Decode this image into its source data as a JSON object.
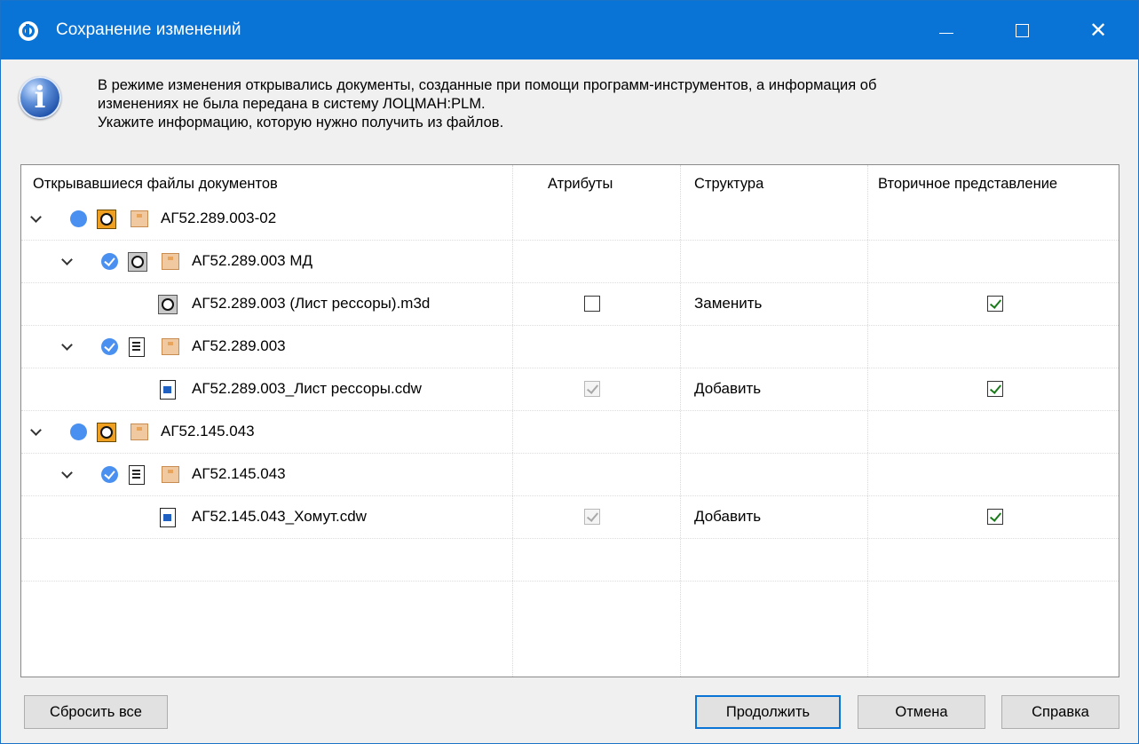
{
  "window": {
    "title": "Сохранение изменений"
  },
  "message": {
    "line1": "В режиме изменения открывались документы, созданные при помощи программ-инструментов, а информация об",
    "line2": "изменениях не была передана в систему ЛОЦМАН:PLM.",
    "line3": "Укажите информацию, которую нужно получить из файлов."
  },
  "table": {
    "headers": {
      "files": "Открывавшиеся файлы документов",
      "attributes": "Атрибуты",
      "structure": "Структура",
      "secondary": "Вторичное представление"
    },
    "rows": [
      {
        "label": "АГ52.289.003-02",
        "level": 0,
        "expanded": true,
        "status": "dot",
        "icon": "assembly-icon"
      },
      {
        "label": "АГ52.289.003 МД",
        "level": 1,
        "expanded": true,
        "status": "check",
        "icon": "part-icon"
      },
      {
        "label": "АГ52.289.003 (Лист рессоры).m3d",
        "level": 2,
        "icon": "part-file-icon",
        "attributes": "unchecked",
        "structure": "Заменить",
        "secondary": "checked"
      },
      {
        "label": "АГ52.289.003",
        "level": 1,
        "expanded": true,
        "status": "check",
        "icon": "document-icon"
      },
      {
        "label": "АГ52.289.003_Лист рессоры.cdw",
        "level": 2,
        "icon": "drawing-file-icon",
        "attributes": "disabled-checked",
        "structure": "Добавить",
        "secondary": "checked"
      },
      {
        "label": "АГ52.145.043",
        "level": 0,
        "expanded": true,
        "status": "dot",
        "icon": "assembly-icon"
      },
      {
        "label": "АГ52.145.043",
        "level": 1,
        "expanded": true,
        "status": "check",
        "icon": "document-icon"
      },
      {
        "label": "АГ52.145.043_Хомут.cdw",
        "level": 2,
        "icon": "drawing-file-icon",
        "attributes": "disabled-checked",
        "structure": "Добавить",
        "secondary": "checked"
      }
    ]
  },
  "buttons": {
    "reset": "Сбросить все",
    "continue": "Продолжить",
    "cancel": "Отмена",
    "help": "Справка"
  }
}
